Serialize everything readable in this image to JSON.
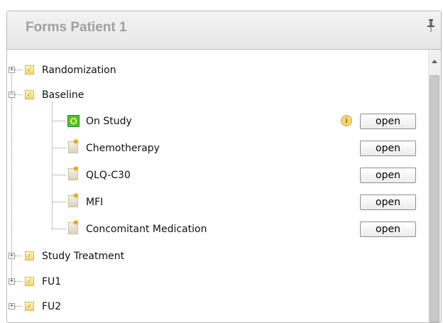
{
  "panel": {
    "title": "Forms Patient 1"
  },
  "tree": {
    "randomization": "Randomization",
    "baseline": "Baseline",
    "baseline_children": [
      {
        "label": "On Study",
        "button": "open"
      },
      {
        "label": "Chemotherapy",
        "button": "open"
      },
      {
        "label": "QLQ-C30",
        "button": "open"
      },
      {
        "label": "MFI",
        "button": "open"
      },
      {
        "label": "Concomitant Medication",
        "button": "open"
      }
    ],
    "study_treatment": "Study Treatment",
    "fu1": "FU1",
    "fu2": "FU2"
  },
  "status_icon_letter": "O",
  "info_icon_letter": "i",
  "colors": {
    "header_title": "#a0a0a0",
    "status_green": "#4fbf3f",
    "check_gold": "#f0d670"
  }
}
